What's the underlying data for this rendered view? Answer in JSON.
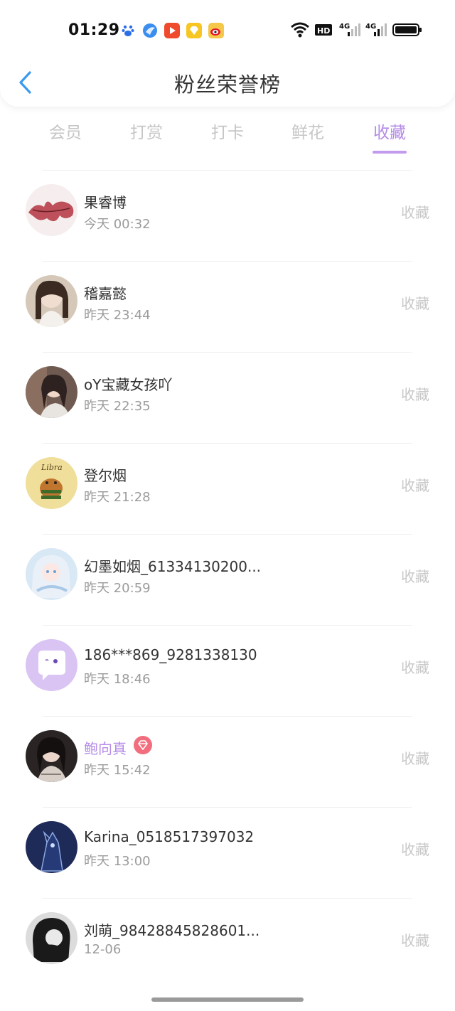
{
  "status_bar": {
    "time": "01:29",
    "app_icons": [
      "baidu-paw-icon",
      "blue-bird-icon",
      "video-play-icon",
      "yellow-diamond-icon",
      "weibo-icon"
    ],
    "right_icons": [
      "wifi-icon",
      "hd-icon",
      "signal-4g-1-icon",
      "signal-4g-2-icon",
      "battery-icon"
    ]
  },
  "header": {
    "title": "粉丝荣誉榜"
  },
  "tabs": [
    {
      "label": "会员"
    },
    {
      "label": "打赏"
    },
    {
      "label": "打卡"
    },
    {
      "label": "鲜花"
    },
    {
      "label": "收藏"
    }
  ],
  "active_tab": "收藏",
  "colors": {
    "accent": "#b48be6",
    "muted": "#c8c8c8",
    "badge": "#f26d7d"
  },
  "rows": [
    {
      "name": "果睿博",
      "time": "今天 00:32",
      "action": "收藏"
    },
    {
      "name": "稽嘉懿",
      "time": "昨天 23:44",
      "action": "收藏"
    },
    {
      "name": "oY宝藏女孩吖",
      "time": "昨天 22:35",
      "action": "收藏"
    },
    {
      "name": "登尔烟",
      "time": "昨天 21:28",
      "action": "收藏"
    },
    {
      "name": "幻墨如烟_61334130200...",
      "time": "昨天 20:59",
      "action": "收藏"
    },
    {
      "name": "186***869_9281338130",
      "time": "昨天 18:46",
      "action": "收藏"
    },
    {
      "name": "鲍向真",
      "time": "昨天 15:42",
      "action": "收藏",
      "vip": true
    },
    {
      "name": "Karina_0518517397032",
      "time": "昨天 13:00",
      "action": "收藏"
    },
    {
      "name": "刘萌_98428845828601...",
      "time": "12-06",
      "action": "收藏"
    }
  ]
}
